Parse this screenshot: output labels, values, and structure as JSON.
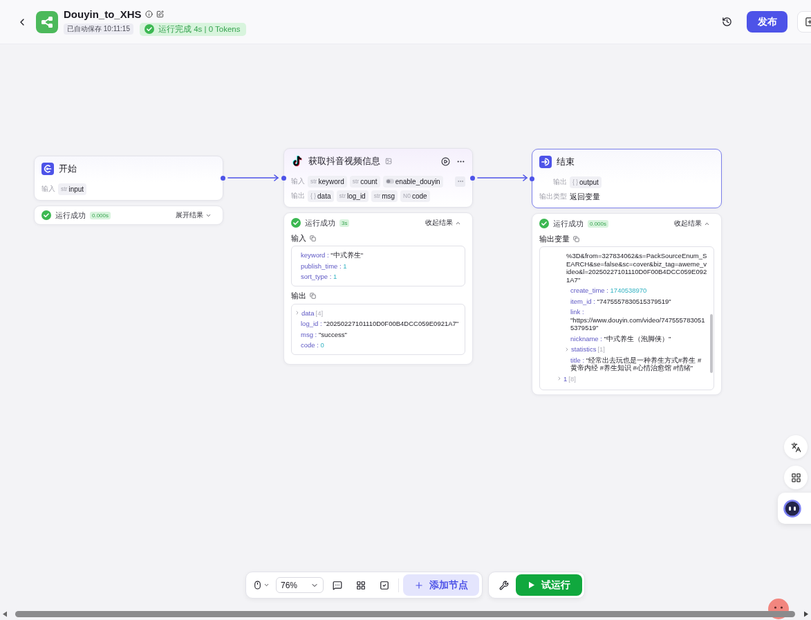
{
  "header": {
    "title": "Douyin_to_XHS",
    "autosave": "已自动保存 10:11:15",
    "run_status": "运行完成 4s | 0 Tokens",
    "publish": "发布"
  },
  "nodes": [
    {
      "kind": "start",
      "title": "开始",
      "selected": false,
      "fields": [
        {
          "label": "输入",
          "params": [
            {
              "kind": "string",
              "tag": "str",
              "name": "input"
            }
          ]
        }
      ],
      "result": {
        "status": "运行成功",
        "duration": "0.000s",
        "toggle": "展开结果",
        "expanded": false
      }
    },
    {
      "kind": "plugin",
      "title": "获取抖音视频信息",
      "selected": false,
      "fields": [
        {
          "label": "输入",
          "params": [
            {
              "kind": "string",
              "tag": "str",
              "name": "keyword"
            },
            {
              "kind": "string",
              "tag": "str",
              "name": "count"
            },
            {
              "kind": "boolean",
              "name": "enable_douyin"
            }
          ],
          "more": true
        },
        {
          "label": "输出",
          "params": [
            {
              "kind": "object",
              "tag": "{ }",
              "name": "data"
            },
            {
              "kind": "string",
              "tag": "str",
              "name": "log_id"
            },
            {
              "kind": "string",
              "tag": "str",
              "name": "msg"
            },
            {
              "kind": "number",
              "tag": "N0",
              "name": "code"
            }
          ]
        }
      ],
      "result": {
        "status": "运行成功",
        "duration": "3s",
        "toggle": "收起结果",
        "expanded": true,
        "sections": [
          {
            "title": "输入",
            "lines": [
              {
                "kind": "string",
                "key": "keyword :",
                "value": "\"中式养生\""
              },
              {
                "kind": "number",
                "key": "publish_time :",
                "value": "1"
              },
              {
                "kind": "number",
                "key": "sort_type :",
                "value": "1"
              }
            ]
          },
          {
            "title": "输出",
            "lines": [
              {
                "kind": "group",
                "key": "data",
                "count": "[4]",
                "expanded": false
              },
              {
                "kind": "string",
                "key": "log_id :",
                "value": "\"20250227101110D0F00B4DCC059E0921A7\""
              },
              {
                "kind": "string",
                "key": "msg :",
                "value": "\"success\""
              },
              {
                "kind": "number",
                "key": "code :",
                "value": "0"
              }
            ]
          }
        ]
      }
    },
    {
      "kind": "end",
      "title": "结束",
      "selected": true,
      "fields": [
        {
          "label": "输出",
          "params": [
            {
              "kind": "object",
              "tag": "{ }",
              "name": "output"
            }
          ]
        },
        {
          "label": "输出类型",
          "value": "返回变量"
        }
      ],
      "result": {
        "status": "运行成功",
        "duration": "0.000s",
        "toggle": "收起结果",
        "expanded": true,
        "sections": [
          {
            "title": "输出变量",
            "lines": [
              {
                "kind": "group",
                "expanded": true,
                "children": [
                  {
                    "kind": "text",
                    "text": "%3D&from=327834062&s=PackSourceEnum_SEARCH&se=false&sc=cover&biz_tag=aweme_video&l=20250227101110D0F00B4DCC059E0921A7\""
                  },
                  {
                    "kind": "number",
                    "key": "create_time :",
                    "value": "1740538970"
                  },
                  {
                    "kind": "string",
                    "key": "item_id :",
                    "value": "\"7475557830515379519\""
                  },
                  {
                    "kind": "string",
                    "key": "link :",
                    "value": "\"https://www.douyin.com/video/7475557830515379519\""
                  },
                  {
                    "kind": "string",
                    "key": "nickname :",
                    "value": "\"中式养生（泡脚侠）\""
                  },
                  {
                    "kind": "group",
                    "key": "statistics",
                    "count": "[1]",
                    "expanded": false
                  },
                  {
                    "kind": "string",
                    "key": "title :",
                    "value": "\"经常出去玩也是一种养生方式#养生 #黄帝内经 #养生知识 #心情治愈馆 #情绪\""
                  }
                ]
              },
              {
                "kind": "group",
                "key": "1",
                "count": "[8]",
                "expanded": false
              }
            ]
          }
        ]
      }
    }
  ],
  "toolbar": {
    "zoom": "76%",
    "add_node": "添加节点",
    "test_run": "试运行"
  }
}
